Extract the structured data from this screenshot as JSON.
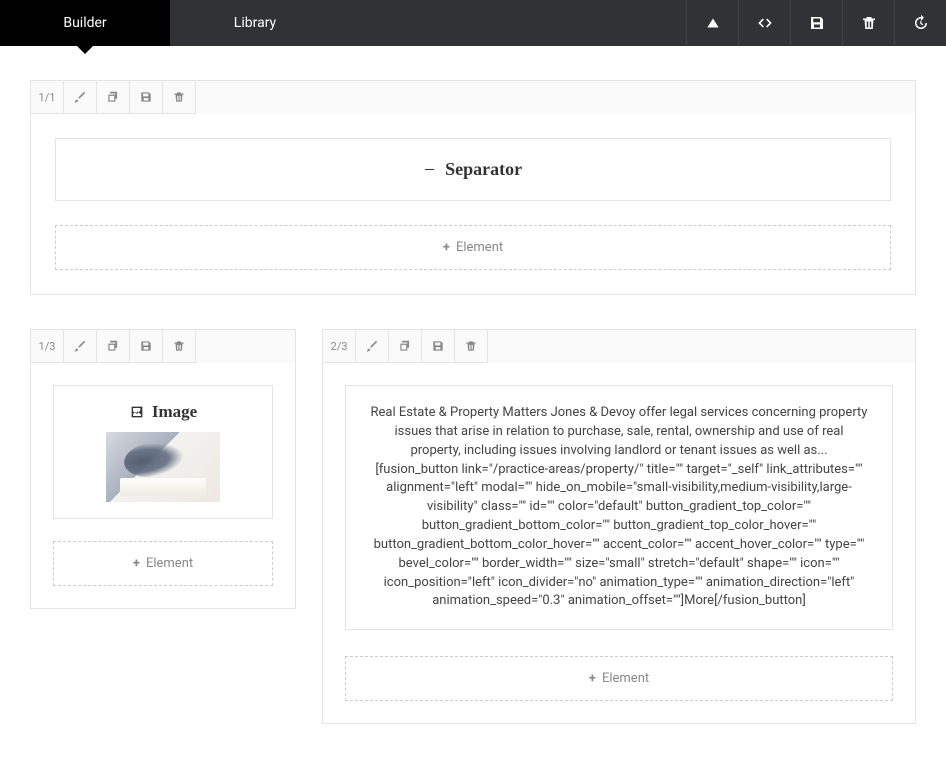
{
  "tabs": {
    "builder": "Builder",
    "library": "Library"
  },
  "section1": {
    "fraction": "1/1",
    "separator_label": "Separator",
    "add_element": "Element"
  },
  "col_left": {
    "fraction": "1/3",
    "image_label": "Image",
    "add_element": "Element"
  },
  "col_right": {
    "fraction": "2/3",
    "text": "Real Estate & Property Matters Jones & Devoy offer legal services concerning property issues that arise in relation to purchase, sale, rental, ownership and use of real property, including issues involving landlord or tenant issues as well as... [fusion_button link=\"/practice-areas/property/\" title=\"\" target=\"_self\" link_attributes=\"\" alignment=\"left\" modal=\"\" hide_on_mobile=\"small-visibility,medium-visibility,large-visibility\" class=\"\" id=\"\" color=\"default\" button_gradient_top_color=\"\" button_gradient_bottom_color=\"\" button_gradient_top_color_hover=\"\" button_gradient_bottom_color_hover=\"\" accent_color=\"\" accent_hover_color=\"\" type=\"\" bevel_color=\"\" border_width=\"\" size=\"small\" stretch=\"default\" shape=\"\" icon=\"\" icon_position=\"left\" icon_divider=\"no\" animation_type=\"\" animation_direction=\"left\" animation_speed=\"0.3\" animation_offset=\"\"]More[/fusion_button]",
    "add_element": "Element"
  }
}
